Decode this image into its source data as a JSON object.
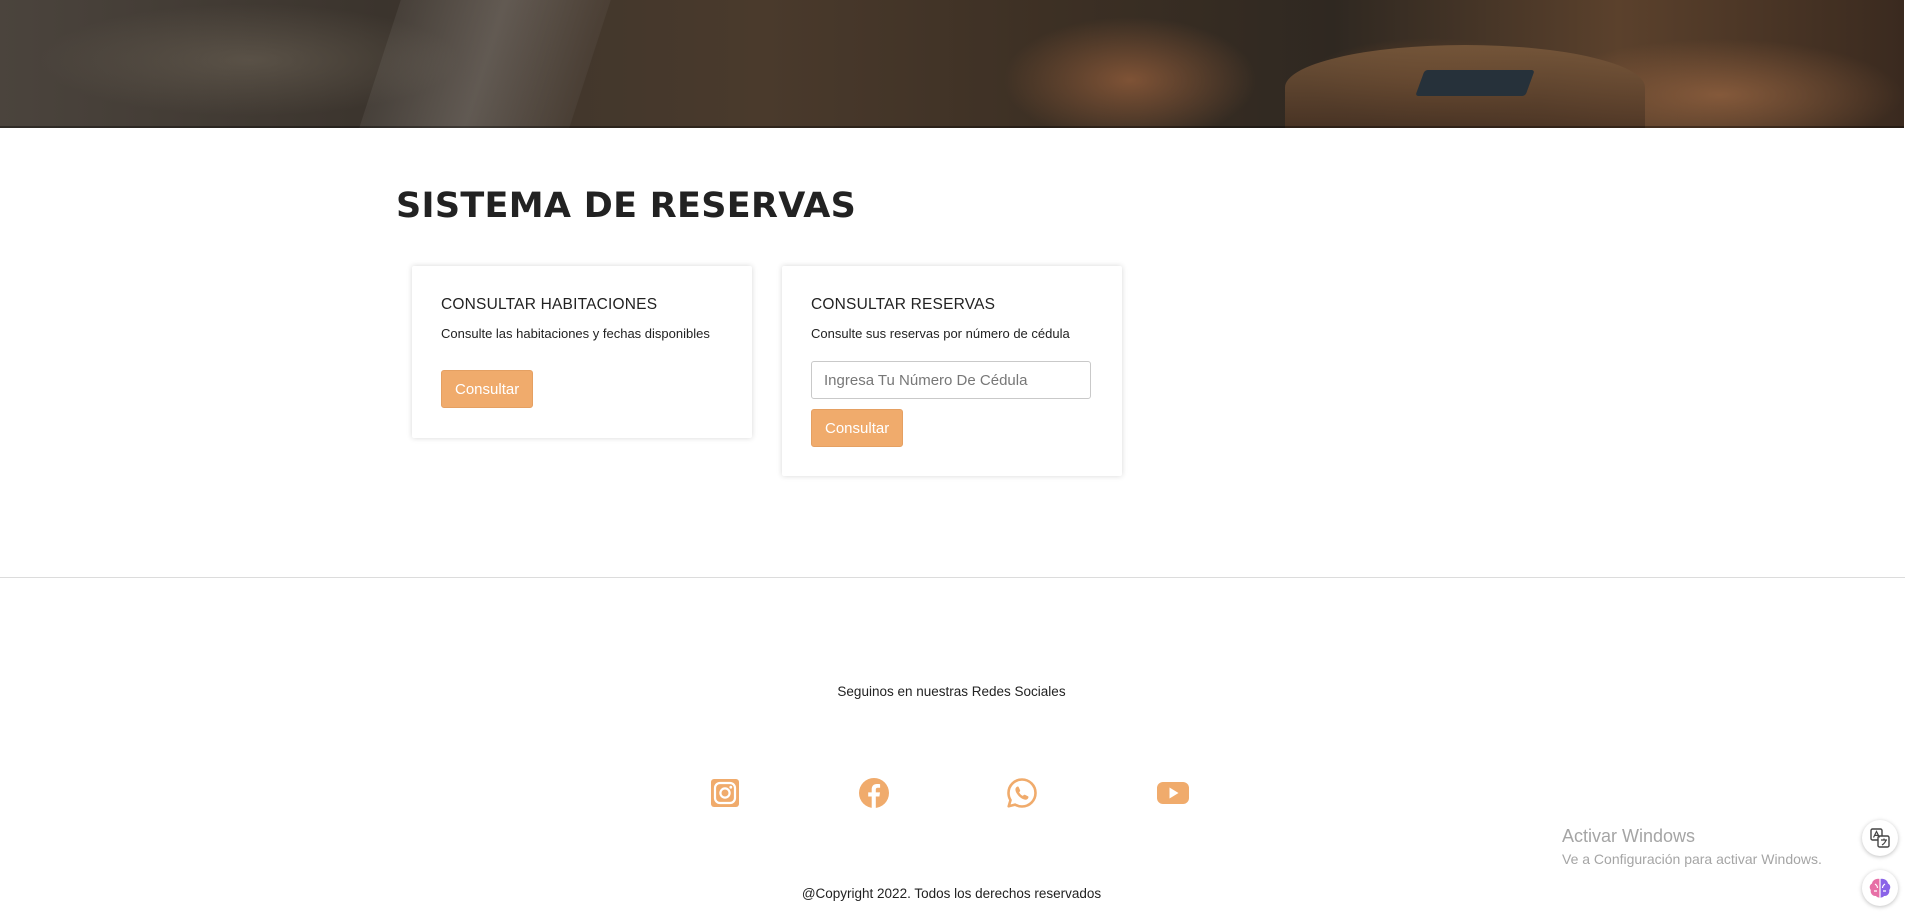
{
  "page": {
    "title": "SISTEMA DE RESERVAS"
  },
  "rooms_card": {
    "title": "CONSULTAR HABITACIONES",
    "description": "Consulte las habitaciones y fechas disponibles",
    "button_label": "Consultar"
  },
  "reservations_card": {
    "title": "CONSULTAR RESERVAS",
    "description": "Consulte sus reservas por número de cédula",
    "input_placeholder": "Ingresa Tu Número De Cédula",
    "input_value": "",
    "button_label": "Consultar"
  },
  "footer": {
    "social_title": "Seguinos en nuestras Redes Sociales",
    "social_icons": [
      "instagram-icon",
      "facebook-icon",
      "whatsapp-icon",
      "youtube-icon"
    ],
    "copyright": "@Copyright 2022. Todos los derechos reservados"
  },
  "windows_watermark": {
    "line1": "Activar Windows",
    "line2": "Ve a Configuración para activar Windows."
  },
  "floating_icons": [
    "translate-icon",
    "brain-icon"
  ],
  "colors": {
    "accent": "#f0ab6c",
    "text": "#222222",
    "watermark": "#a5a5a5"
  }
}
